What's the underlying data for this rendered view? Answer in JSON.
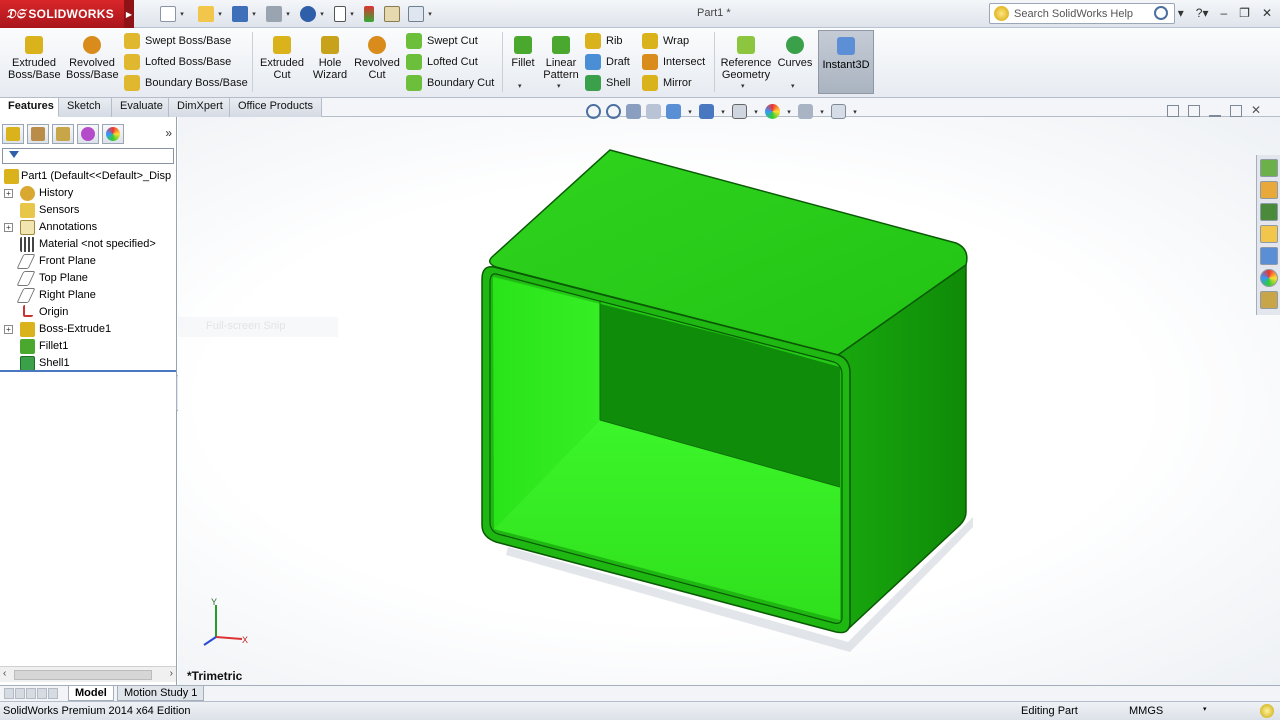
{
  "app": {
    "logo_text": "SOLIDWORKS",
    "document_title": "Part1 *",
    "search_placeholder": "Search SolidWorks Help"
  },
  "ribbon": {
    "large_buttons": [
      {
        "id": "extruded-boss",
        "label": "Extruded Boss/Base",
        "color": "#d9b21c"
      },
      {
        "id": "revolved-boss",
        "label": "Revolved Boss/Base",
        "color": "#d98b1c"
      },
      {
        "id": "extruded-cut",
        "label": "Extruded Cut",
        "color": "#d9b21c"
      },
      {
        "id": "hole-wizard",
        "label": "Hole Wizard",
        "color": "#c9a21c"
      },
      {
        "id": "revolved-cut",
        "label": "Revolved Cut",
        "color": "#d98b1c"
      },
      {
        "id": "fillet",
        "label": "Fillet",
        "color": "#4aa82e"
      },
      {
        "id": "linear-pattern",
        "label": "Linear Pattern",
        "color": "#4aa82e"
      },
      {
        "id": "reference-geometry",
        "label": "Reference Geometry",
        "color": "#8cc63f"
      },
      {
        "id": "curves",
        "label": "Curves",
        "color": "#3aa04a"
      },
      {
        "id": "instant3d",
        "label": "Instant3D",
        "color": "#5d8fd6"
      }
    ],
    "small_buttons": [
      {
        "id": "swept-boss",
        "label": "Swept Boss/Base"
      },
      {
        "id": "lofted-boss",
        "label": "Lofted Boss/Base"
      },
      {
        "id": "boundary-boss",
        "label": "Boundary Boss/Base"
      },
      {
        "id": "swept-cut",
        "label": "Swept Cut"
      },
      {
        "id": "lofted-cut",
        "label": "Lofted Cut"
      },
      {
        "id": "boundary-cut",
        "label": "Boundary Cut"
      },
      {
        "id": "rib",
        "label": "Rib"
      },
      {
        "id": "draft",
        "label": "Draft"
      },
      {
        "id": "shell",
        "label": "Shell"
      },
      {
        "id": "wrap",
        "label": "Wrap"
      },
      {
        "id": "intersect",
        "label": "Intersect"
      },
      {
        "id": "mirror",
        "label": "Mirror"
      }
    ]
  },
  "tabs": [
    "Features",
    "Sketch",
    "Evaluate",
    "DimXpert",
    "Office Products"
  ],
  "tree": {
    "root": "Part1  (Default<<Default>_Disp",
    "items": [
      {
        "label": "History",
        "expandable": true,
        "icon": "history-icon"
      },
      {
        "label": "Sensors",
        "expandable": false,
        "icon": "sensors-icon"
      },
      {
        "label": "Annotations",
        "expandable": true,
        "icon": "annotations-icon"
      },
      {
        "label": "Material <not specified>",
        "expandable": false,
        "icon": "material-icon"
      },
      {
        "label": "Front Plane",
        "expandable": false,
        "icon": "plane-icon"
      },
      {
        "label": "Top Plane",
        "expandable": false,
        "icon": "plane-icon"
      },
      {
        "label": "Right Plane",
        "expandable": false,
        "icon": "plane-icon"
      },
      {
        "label": "Origin",
        "expandable": false,
        "icon": "origin-icon"
      },
      {
        "label": "Boss-Extrude1",
        "expandable": true,
        "icon": "extrude-feature-icon"
      },
      {
        "label": "Fillet1",
        "expandable": false,
        "icon": "fillet-feature-icon"
      },
      {
        "label": "Shell1",
        "expandable": false,
        "icon": "shell-feature-icon"
      }
    ]
  },
  "viewport": {
    "view_name": "*Trimetric",
    "snip_text": "Full-screen Snip",
    "model_color": "#33dd22",
    "triad": {
      "x": "X",
      "y": "Y"
    }
  },
  "model_tabs": [
    "Model",
    "Motion Study 1"
  ],
  "status": {
    "edition": "SolidWorks Premium 2014 x64 Edition",
    "mode": "Editing Part",
    "units": "MMGS"
  }
}
